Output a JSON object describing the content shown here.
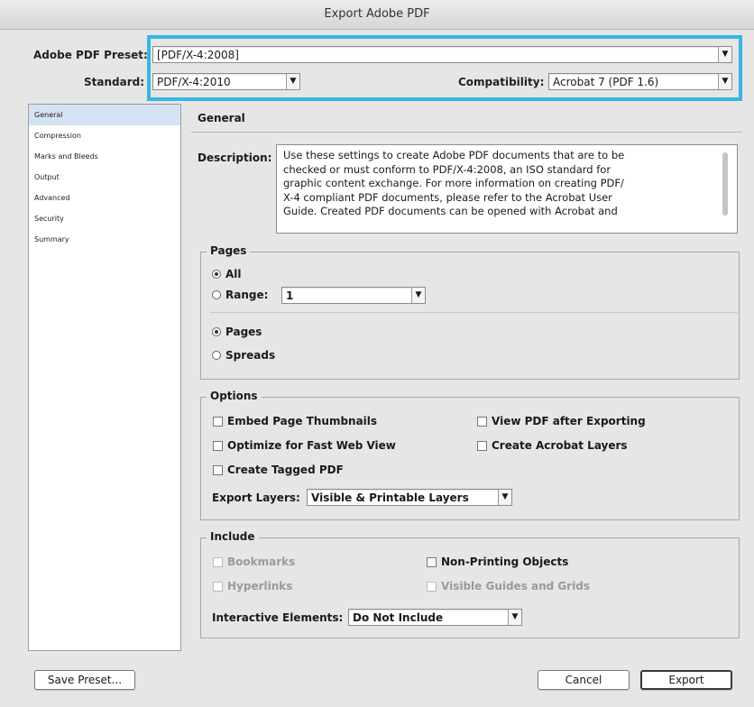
{
  "window": {
    "title": "Export Adobe PDF"
  },
  "preset": {
    "label": "Adobe PDF Preset:",
    "value": "[PDF/X-4:2008]"
  },
  "standard": {
    "label": "Standard:",
    "value": "PDF/X-4:2010"
  },
  "compatibility": {
    "label": "Compatibility:",
    "value": "Acrobat 7 (PDF 1.6)"
  },
  "sidebar": {
    "items": [
      {
        "label": "General",
        "active": true
      },
      {
        "label": "Compression"
      },
      {
        "label": "Marks and Bleeds"
      },
      {
        "label": "Output"
      },
      {
        "label": "Advanced"
      },
      {
        "label": "Security"
      },
      {
        "label": "Summary"
      }
    ]
  },
  "panel": {
    "title": "General",
    "description_label": "Description:",
    "description_lines": [
      "Use these settings to create Adobe PDF documents that are to be",
      "checked or must conform to PDF/X-4:2008, an ISO standard for",
      "graphic content exchange.  For more information on creating PDF/",
      "X-4 compliant PDF documents, please refer to the Acrobat User",
      "Guide.  Created PDF documents can be opened with Acrobat and"
    ]
  },
  "pages": {
    "title": "Pages",
    "all": "All",
    "range": "Range:",
    "range_value": "1",
    "pages_opt": "Pages",
    "spreads_opt": "Spreads"
  },
  "options": {
    "title": "Options",
    "embed": "Embed Page Thumbnails",
    "view": "View PDF after Exporting",
    "optimize": "Optimize for Fast Web View",
    "layers": "Create Acrobat Layers",
    "tagged": "Create Tagged PDF",
    "export_layers_label": "Export Layers:",
    "export_layers_value": "Visible & Printable Layers"
  },
  "include": {
    "title": "Include",
    "bookmarks": "Bookmarks",
    "nonprinting": "Non-Printing Objects",
    "hyperlinks": "Hyperlinks",
    "guides": "Visible Guides and Grids",
    "interactive_label": "Interactive Elements:",
    "interactive_value": "Do Not Include"
  },
  "buttons": {
    "save_preset": "Save Preset...",
    "cancel": "Cancel",
    "export": "Export"
  },
  "colors": {
    "highlight": "#38b6e6",
    "sidebar_active": "#d5e2f3"
  }
}
